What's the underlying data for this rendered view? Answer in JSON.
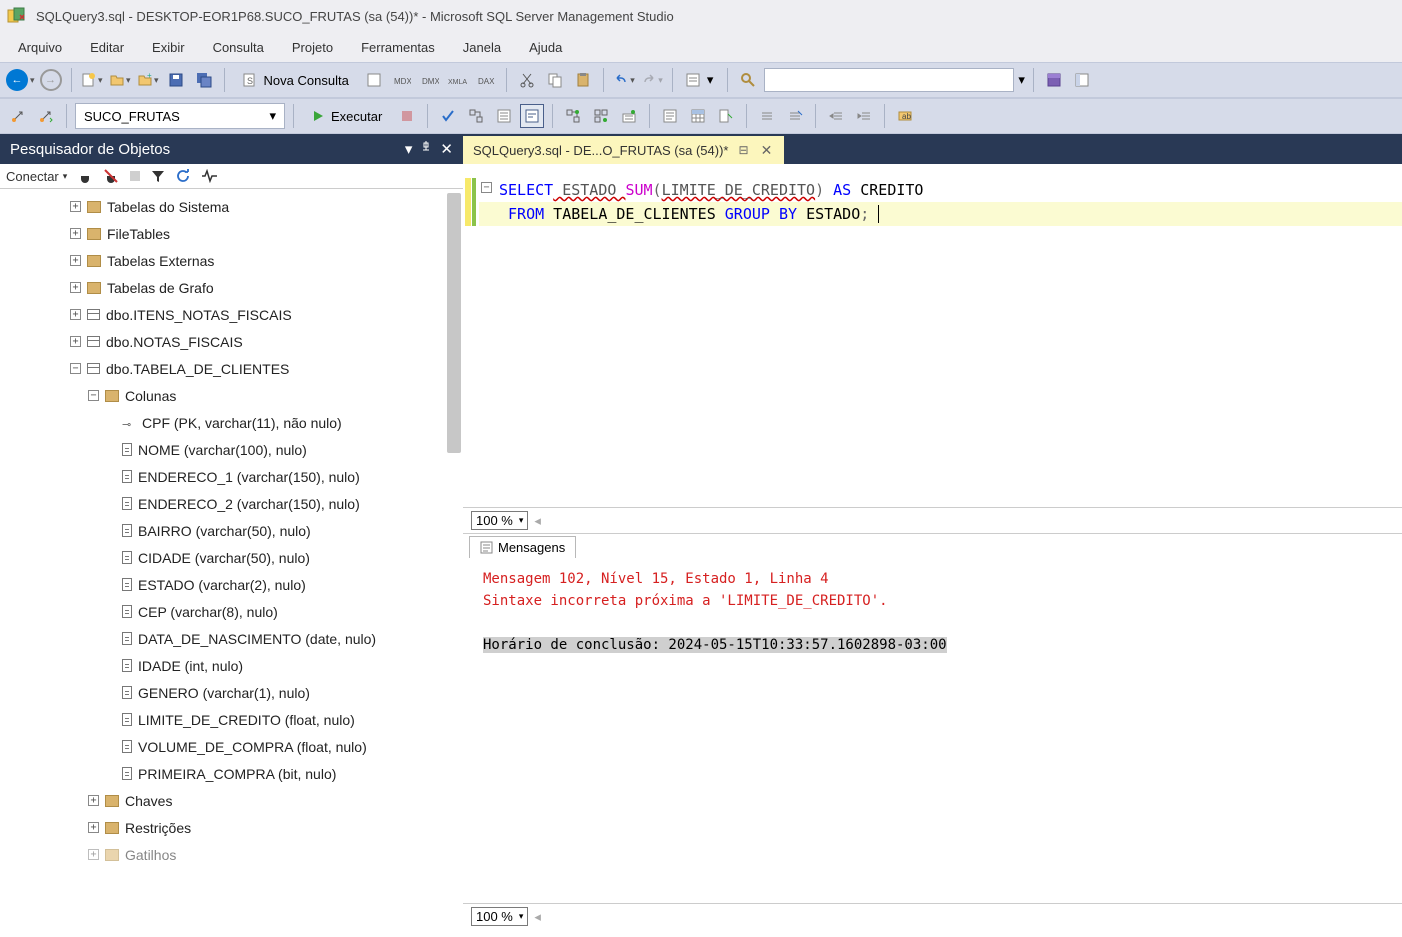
{
  "titlebar": {
    "text": "SQLQuery3.sql - DESKTOP-EOR1P68.SUCO_FRUTAS (sa (54))* - Microsoft SQL Server Management Studio"
  },
  "menu": {
    "arquivo": "Arquivo",
    "editar": "Editar",
    "exibir": "Exibir",
    "consulta": "Consulta",
    "projeto": "Projeto",
    "ferramentas": "Ferramentas",
    "janela": "Janela",
    "ajuda": "Ajuda"
  },
  "toolbar1": {
    "nova_consulta": "Nova Consulta"
  },
  "toolbar2": {
    "database": "SUCO_FRUTAS",
    "executar": "Executar"
  },
  "object_explorer": {
    "title": "Pesquisador de Objetos",
    "conectar": "Conectar",
    "tree": {
      "tabelas_sistema": "Tabelas do Sistema",
      "filetables": "FileTables",
      "tabelas_externas": "Tabelas Externas",
      "tabelas_grafo": "Tabelas de Grafo",
      "itens_notas": "dbo.ITENS_NOTAS_FISCAIS",
      "notas_fiscais": "dbo.NOTAS_FISCAIS",
      "tabela_clientes": "dbo.TABELA_DE_CLIENTES",
      "colunas": "Colunas",
      "cols": {
        "cpf": "CPF (PK, varchar(11), não nulo)",
        "nome": "NOME (varchar(100), nulo)",
        "end1": "ENDERECO_1 (varchar(150), nulo)",
        "end2": "ENDERECO_2 (varchar(150), nulo)",
        "bairro": "BAIRRO (varchar(50), nulo)",
        "cidade": "CIDADE (varchar(50), nulo)",
        "estado": "ESTADO (varchar(2), nulo)",
        "cep": "CEP (varchar(8), nulo)",
        "datan": "DATA_DE_NASCIMENTO (date, nulo)",
        "idade": "IDADE (int, nulo)",
        "genero": "GENERO (varchar(1), nulo)",
        "limite": "LIMITE_DE_CREDITO (float, nulo)",
        "volume": "VOLUME_DE_COMPRA (float, nulo)",
        "primeira": "PRIMEIRA_COMPRA (bit, nulo)"
      },
      "chaves": "Chaves",
      "restricoes": "Restrições",
      "gatilhos": "Gatilhos"
    }
  },
  "editor": {
    "tab_label": "SQLQuery3.sql - DE...O_FRUTAS (sa (54))*",
    "zoom": "100 %",
    "sql": {
      "select": "SELECT",
      "estado": " ESTADO ",
      "sum": "SUM",
      "lparen": "(",
      "limite": "LIMITE_DE_CREDITO",
      "rparen": ")",
      "as": " AS ",
      "credito": "CREDITO",
      "from": "FROM",
      "tabela": " TABELA_DE_CLIENTES ",
      "group": "GROUP",
      "by": " BY ",
      "estado2": "ESTADO",
      "semi": ";"
    }
  },
  "messages": {
    "tab": "Mensagens",
    "line1": "Mensagem 102, Nível 15, Estado 1, Linha 4",
    "line2": "Sintaxe incorreta próxima a 'LIMITE_DE_CREDITO'.",
    "ts": "Horário de conclusão: 2024-05-15T10:33:57.1602898-03:00"
  }
}
